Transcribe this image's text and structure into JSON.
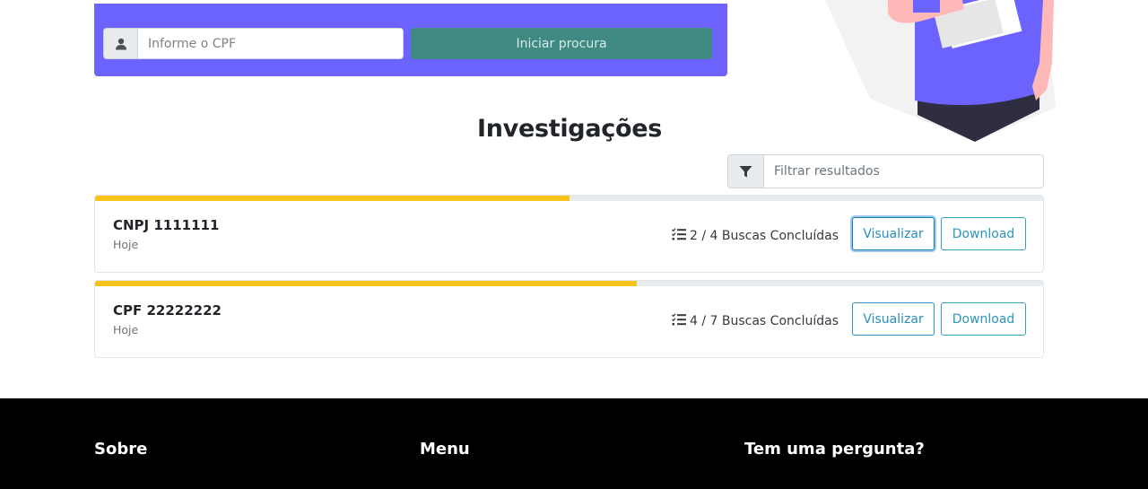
{
  "search": {
    "cpf_placeholder": "Informe o CPF",
    "button_label": "Iniciar procura",
    "user_icon": "user-icon"
  },
  "investigations": {
    "title": "Investigações",
    "filter_placeholder": "Filtrar resultados",
    "filter_icon": "filter-icon",
    "items": [
      {
        "title": "CNPJ 1111111",
        "date": "Hoje",
        "status": "2 / 4 Buscas Concluídas",
        "progress": 0.5,
        "view_label": "Visualizar",
        "download_label": "Download"
      },
      {
        "title": "CPF 22222222",
        "date": "Hoje",
        "status": "4 / 7 Buscas Concluídas",
        "progress": 0.571,
        "view_label": "Visualizar",
        "download_label": "Download"
      }
    ]
  },
  "footer": {
    "about": "Sobre",
    "menu": "Menu",
    "question": "Tem uma pergunta?"
  },
  "colors": {
    "panel": "#6c63ff",
    "search_button": "#3f8a82",
    "progress": "#f6c21c",
    "outline_button": "#2a8fc0",
    "footer": "#000000"
  }
}
